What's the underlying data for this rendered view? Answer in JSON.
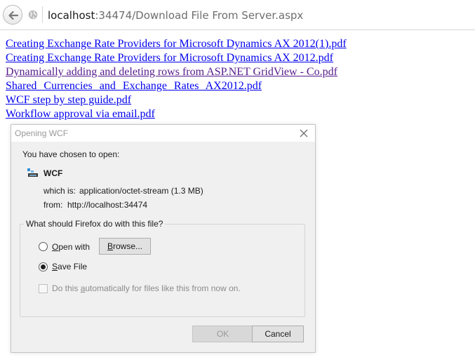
{
  "address_bar": {
    "host": "localhost",
    "path": ":34474/Download File From Server.aspx"
  },
  "files": [
    {
      "label": "Creating Exchange Rate Providers for Microsoft Dynamics AX 2012(1).pdf"
    },
    {
      "label": "Creating Exchange Rate Providers for Microsoft Dynamics AX 2012.pdf"
    },
    {
      "label": "Dynamically adding and deleting rows from ASP.NET GridView - Co.pdf"
    },
    {
      "label": "Shared Currencies and Exchange Rates AX2012.pdf"
    },
    {
      "label": "WCF step by step guide.pdf"
    },
    {
      "label": "Workflow approval via email.pdf"
    }
  ],
  "dialog": {
    "title": "Opening WCF",
    "chosen_label": "You have chosen to open:",
    "file_name": "WCF",
    "which_label": "which is:",
    "which_value": "application/octet-stream (1.3 MB)",
    "from_label": "from:",
    "from_value": "http://localhost:34474",
    "question": "What should Firefox do with this file?",
    "open_with": {
      "u": "O",
      "rest": "pen with"
    },
    "browse": {
      "u": "B",
      "rest": "rowse..."
    },
    "save_file": {
      "u": "S",
      "rest": "ave File"
    },
    "auto": {
      "pre": "Do this ",
      "u": "a",
      "rest": "utomatically for files like this from now on."
    },
    "ok_label": "OK",
    "cancel_label": "Cancel"
  },
  "icons": {
    "back": "back-arrow-icon",
    "globe": "globe-icon",
    "close": "close-icon",
    "file": "application-file-icon"
  },
  "colors": {
    "link": "#0000ee",
    "visited_link": "#551a8b"
  }
}
